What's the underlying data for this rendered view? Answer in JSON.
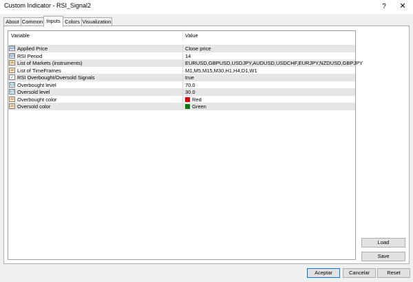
{
  "window": {
    "title": "Custom Indicator - RSI_Signal2",
    "help_glyph": "?",
    "close_glyph": "✕"
  },
  "tabs": [
    {
      "label": "About",
      "active": false
    },
    {
      "label": "Common",
      "active": false
    },
    {
      "label": "Inputs",
      "active": true
    },
    {
      "label": "Colors",
      "active": false
    },
    {
      "label": "Visualization",
      "active": false
    }
  ],
  "grid": {
    "headers": {
      "variable": "Variable",
      "value": "Value"
    },
    "rows": [
      {
        "icon": "enum-icon",
        "glyph": "123",
        "variable": "Applied Price",
        "value": "Close price"
      },
      {
        "icon": "integer-icon",
        "glyph": "123",
        "variable": "RSI Period",
        "value": "14"
      },
      {
        "icon": "string-icon",
        "glyph": "ab",
        "variable": "List of Markets (instruments)",
        "value": "EURUSD,GBPUSD,USDJPY,AUDUSD,USDCHF,EURJPY,NZDUSD,GBPJPY"
      },
      {
        "icon": "string-icon",
        "glyph": "ab",
        "variable": "List of TimeFrames",
        "value": "M1,M5,M15,M30,H1,H4,D1,W1"
      },
      {
        "icon": "bool-icon",
        "glyph": "✓",
        "variable": "RSI Overbought/Oversold Signals",
        "value": "true"
      },
      {
        "icon": "double-icon",
        "glyph": "1/2",
        "variable": "Overbought level",
        "value": "70.0"
      },
      {
        "icon": "double-icon",
        "glyph": "1/2",
        "variable": "Oversold level",
        "value": "30.0"
      },
      {
        "icon": "color-icon",
        "glyph": "ab",
        "variable": "Overbought color",
        "value": "Red",
        "swatch": "#e00000"
      },
      {
        "icon": "color-icon",
        "glyph": "ab",
        "variable": "Oversold color",
        "value": "Green",
        "swatch": "#0a7a0a"
      }
    ]
  },
  "buttons": {
    "load": "Load",
    "save": "Save",
    "accept": "Aceptar",
    "cancel": "Cancelar",
    "reset": "Reset"
  }
}
